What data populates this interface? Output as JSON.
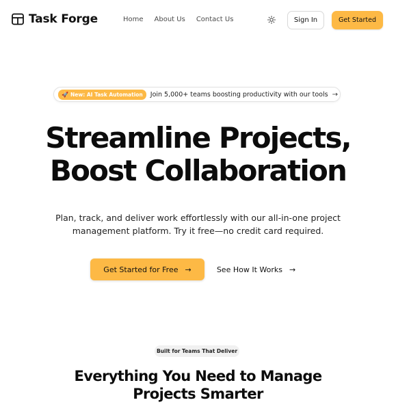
{
  "header": {
    "brand_name": "Task Forge",
    "brand_icon": "table-grid-icon",
    "nav": [
      {
        "label": "Home"
      },
      {
        "label": "About Us"
      },
      {
        "label": "Contact Us"
      }
    ],
    "theme_toggle_icon": "sun-icon",
    "sign_in_label": "Sign In",
    "get_started_label": "Get Started"
  },
  "announcement": {
    "badge_label": "New: AI Task Automation",
    "badge_icon": "rocket-icon",
    "text": "Join 5,000+ teams boosting productivity with our tools",
    "arrow_icon": "arrow-right-icon"
  },
  "hero": {
    "title_line1": "Streamline Projects,",
    "title_line2": "Boost Collaboration",
    "subtitle": "Plan, track, and deliver work effortlessly with our all-in-one project management platform. Try it free—no credit card required.",
    "primary_cta": "Get Started for Free",
    "secondary_cta": "See How It Works"
  },
  "features": {
    "badge": "Built for Teams That Deliver",
    "title_line1": "Everything You Need to Manage",
    "title_line2": "Projects Smarter"
  },
  "colors": {
    "accent": "#fdb945",
    "text": "#111111",
    "background": "#ffffff"
  }
}
